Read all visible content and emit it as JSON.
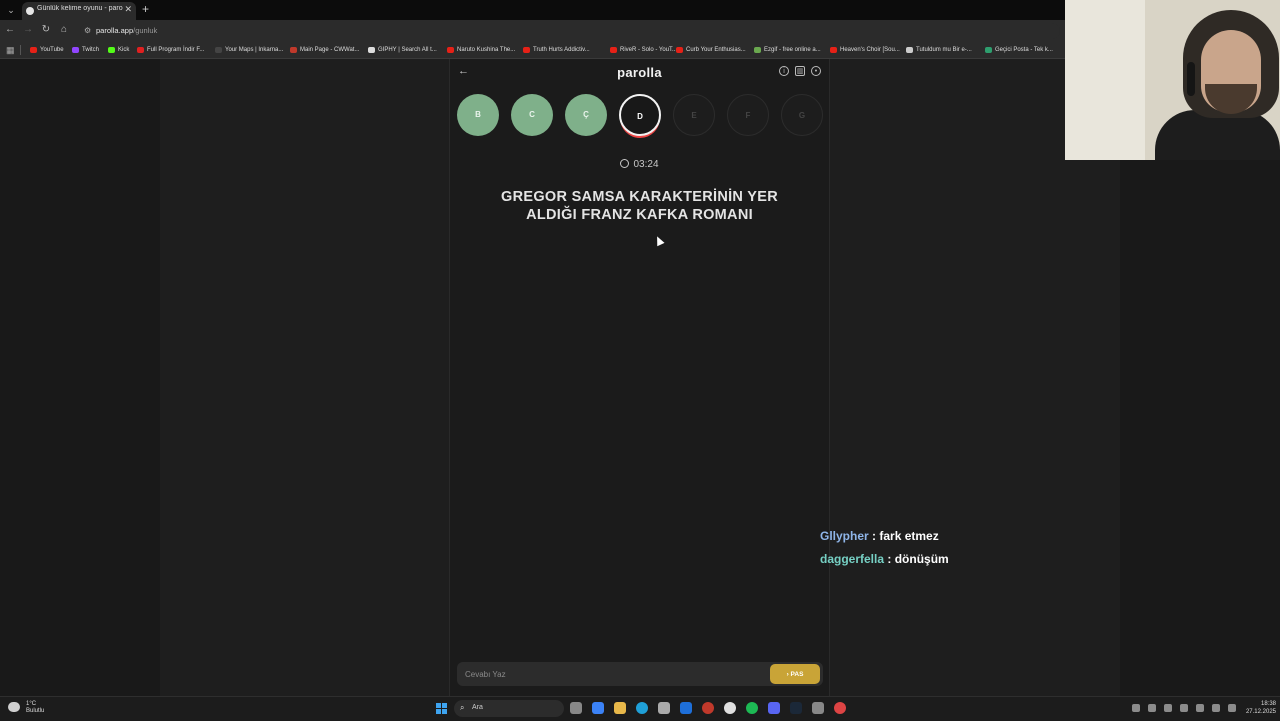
{
  "browser": {
    "tab_title": "Günlük kelime oyunu - parolla",
    "url_host": "parolla.app",
    "url_path": "/gunluk",
    "bookmarks": [
      {
        "label": "YouTube",
        "color": "#e62117"
      },
      {
        "label": "Twitch",
        "color": "#9146ff"
      },
      {
        "label": "Kick",
        "color": "#53fc18"
      },
      {
        "label": "Full Program İndir F...",
        "color": "#e02020"
      },
      {
        "label": "Your Maps | Inkarna...",
        "color": "#444444"
      },
      {
        "label": "Main Page - CWWat...",
        "color": "#c0392b"
      },
      {
        "label": "GIPHY | Search All t...",
        "color": "#dddddd"
      },
      {
        "label": "Naruto Kushina The...",
        "color": "#e62117"
      },
      {
        "label": "Truth Hurts Addictiv...",
        "color": "#e62117"
      },
      {
        "label": "RiveR - Solo - YouT...",
        "color": "#e62117"
      },
      {
        "label": "Curb Your Enthusias...",
        "color": "#e62117"
      },
      {
        "label": "Ezgif - free online a...",
        "color": "#6aa84f"
      },
      {
        "label": "Heaven's Choir [Sou...",
        "color": "#e62117"
      },
      {
        "label": "Tutuldum mu Bir e-...",
        "color": "#cccccc"
      },
      {
        "label": "Geçici Posta - Tek k...",
        "color": "#2e9e6e"
      }
    ]
  },
  "game": {
    "logo": "parolla",
    "letters": [
      {
        "char": "B",
        "state": "done"
      },
      {
        "char": "C",
        "state": "done"
      },
      {
        "char": "Ç",
        "state": "done"
      },
      {
        "char": "D",
        "state": "active"
      },
      {
        "char": "E",
        "state": "todo"
      },
      {
        "char": "F",
        "state": "todo"
      },
      {
        "char": "G",
        "state": "todo"
      }
    ],
    "timer": "03:24",
    "question": "GREGOR SAMSA KARAKTERİNİN YER ALDIĞI FRANZ KAFKA ROMANI",
    "answer_placeholder": "Cevabı Yaz",
    "pass_label": "› PAS",
    "header_icons": [
      "info-icon",
      "stats-icon",
      "profile-icon"
    ]
  },
  "chat": [
    {
      "user": "Gllypher",
      "message": "fark etmez",
      "color": "#8fb5e8"
    },
    {
      "user": "daggerfella",
      "message": "dönüşüm",
      "color": "#76d0c4"
    }
  ],
  "taskbar": {
    "weather_temp": "1°C",
    "weather_desc": "Bulutlu",
    "search_label": "Ara",
    "time": "18:38",
    "date": "27.12.2025"
  }
}
